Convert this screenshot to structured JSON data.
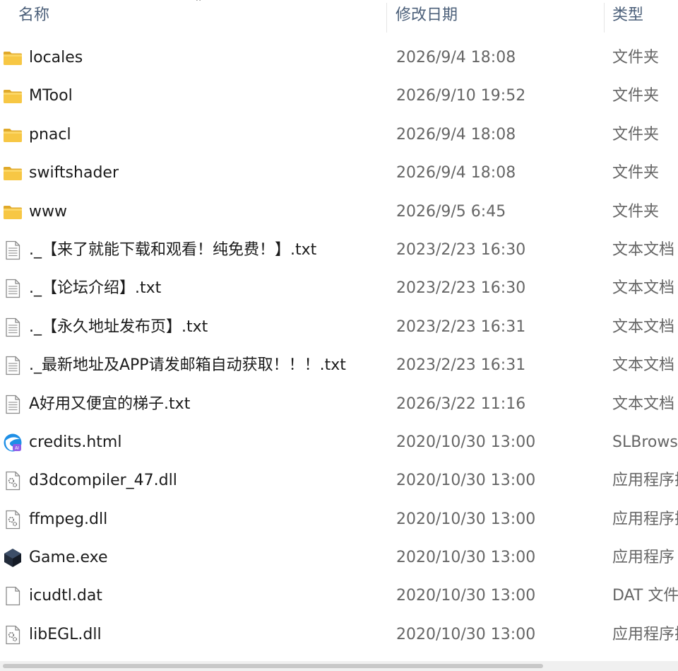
{
  "columns": {
    "name": "名称",
    "date": "修改日期",
    "type": "类型"
  },
  "files": [
    {
      "icon": "folder-icon",
      "name": "locales",
      "date": "2026/9/4 18:08",
      "type": "文件夹"
    },
    {
      "icon": "folder-icon",
      "name": "MTool",
      "date": "2026/9/10 19:52",
      "type": "文件夹"
    },
    {
      "icon": "folder-icon",
      "name": "pnacl",
      "date": "2026/9/4 18:08",
      "type": "文件夹"
    },
    {
      "icon": "folder-icon",
      "name": "swiftshader",
      "date": "2026/9/4 18:08",
      "type": "文件夹"
    },
    {
      "icon": "folder-icon",
      "name": "www",
      "date": "2026/9/5 6:45",
      "type": "文件夹"
    },
    {
      "icon": "text-file-icon",
      "name": "._【来了就能下载和观看！纯免费！】.txt",
      "date": "2023/2/23 16:30",
      "type": "文本文档"
    },
    {
      "icon": "text-file-icon",
      "name": "._【论坛介绍】.txt",
      "date": "2023/2/23 16:30",
      "type": "文本文档"
    },
    {
      "icon": "text-file-icon",
      "name": "._【永久地址发布页】.txt",
      "date": "2023/2/23 16:31",
      "type": "文本文档"
    },
    {
      "icon": "text-file-icon",
      "name": "._最新地址及APP请发邮箱自动获取！！！.txt",
      "date": "2023/2/23 16:31",
      "type": "文本文档"
    },
    {
      "icon": "text-file-icon",
      "name": "A好用又便宜的梯子.txt",
      "date": "2026/3/22 11:16",
      "type": "文本文档"
    },
    {
      "icon": "browser-html-icon",
      "name": "credits.html",
      "date": "2020/10/30 13:00",
      "type": "SLBrowser"
    },
    {
      "icon": "dll-file-icon",
      "name": "d3dcompiler_47.dll",
      "date": "2020/10/30 13:00",
      "type": "应用程序扩展"
    },
    {
      "icon": "dll-file-icon",
      "name": "ffmpeg.dll",
      "date": "2020/10/30 13:00",
      "type": "应用程序扩展"
    },
    {
      "icon": "game-exe-icon",
      "name": "Game.exe",
      "date": "2020/10/30 13:00",
      "type": "应用程序"
    },
    {
      "icon": "blank-file-icon",
      "name": "icudtl.dat",
      "date": "2020/10/30 13:00",
      "type": "DAT 文件"
    },
    {
      "icon": "dll-file-icon",
      "name": "libEGL.dll",
      "date": "2020/10/30 13:00",
      "type": "应用程序扩展"
    }
  ],
  "colors": {
    "folder": "#f5c33b",
    "header_text": "#4c607a",
    "secondary_text": "#666666"
  }
}
